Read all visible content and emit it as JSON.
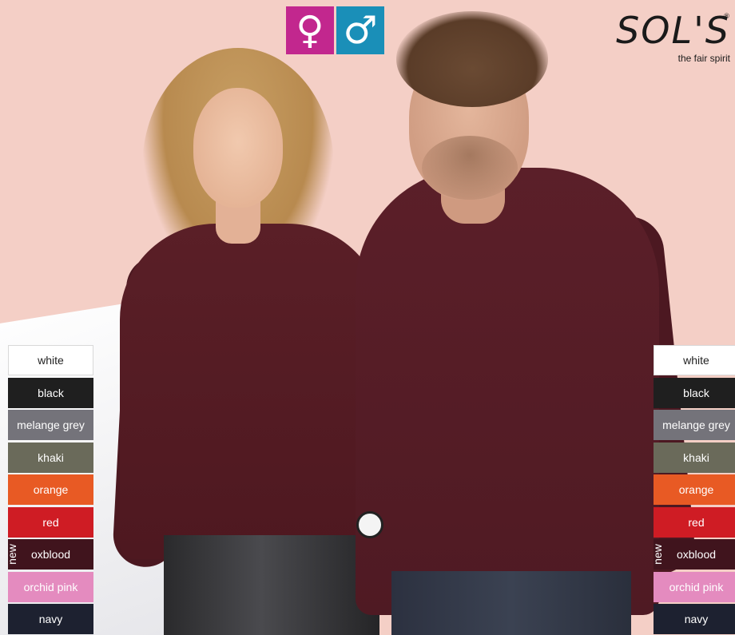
{
  "brand": {
    "name": "SOL'S",
    "registered": "®",
    "tagline": "the fair spirit"
  },
  "gender_icons": [
    {
      "symbol": "♀",
      "color": "#c2278e"
    },
    {
      "symbol": "♂",
      "color": "#1a8fb8"
    }
  ],
  "swatches": [
    {
      "label": "white",
      "color": "#ffffff",
      "text_color": "#222222"
    },
    {
      "label": "black",
      "color": "#1f1f1f",
      "text_color": "#ffffff"
    },
    {
      "label": "melange grey",
      "color": "#74737a",
      "text_color": "#ffffff"
    },
    {
      "label": "khaki",
      "color": "#6a6a5a",
      "text_color": "#ffffff"
    },
    {
      "label": "orange",
      "color": "#e85a24",
      "text_color": "#ffffff"
    },
    {
      "label": "red",
      "color": "#cf1c24",
      "text_color": "#ffffff"
    },
    {
      "label": "oxblood",
      "color": "#40141d",
      "text_color": "#ffffff",
      "new": "new"
    },
    {
      "label": "orchid pink",
      "color": "#e48bbf",
      "text_color": "#ffffff"
    },
    {
      "label": "navy",
      "color": "#1d2130",
      "text_color": "#ffffff"
    }
  ],
  "colors": {
    "background": "#f4cfc6",
    "shirt": "#54202a"
  }
}
